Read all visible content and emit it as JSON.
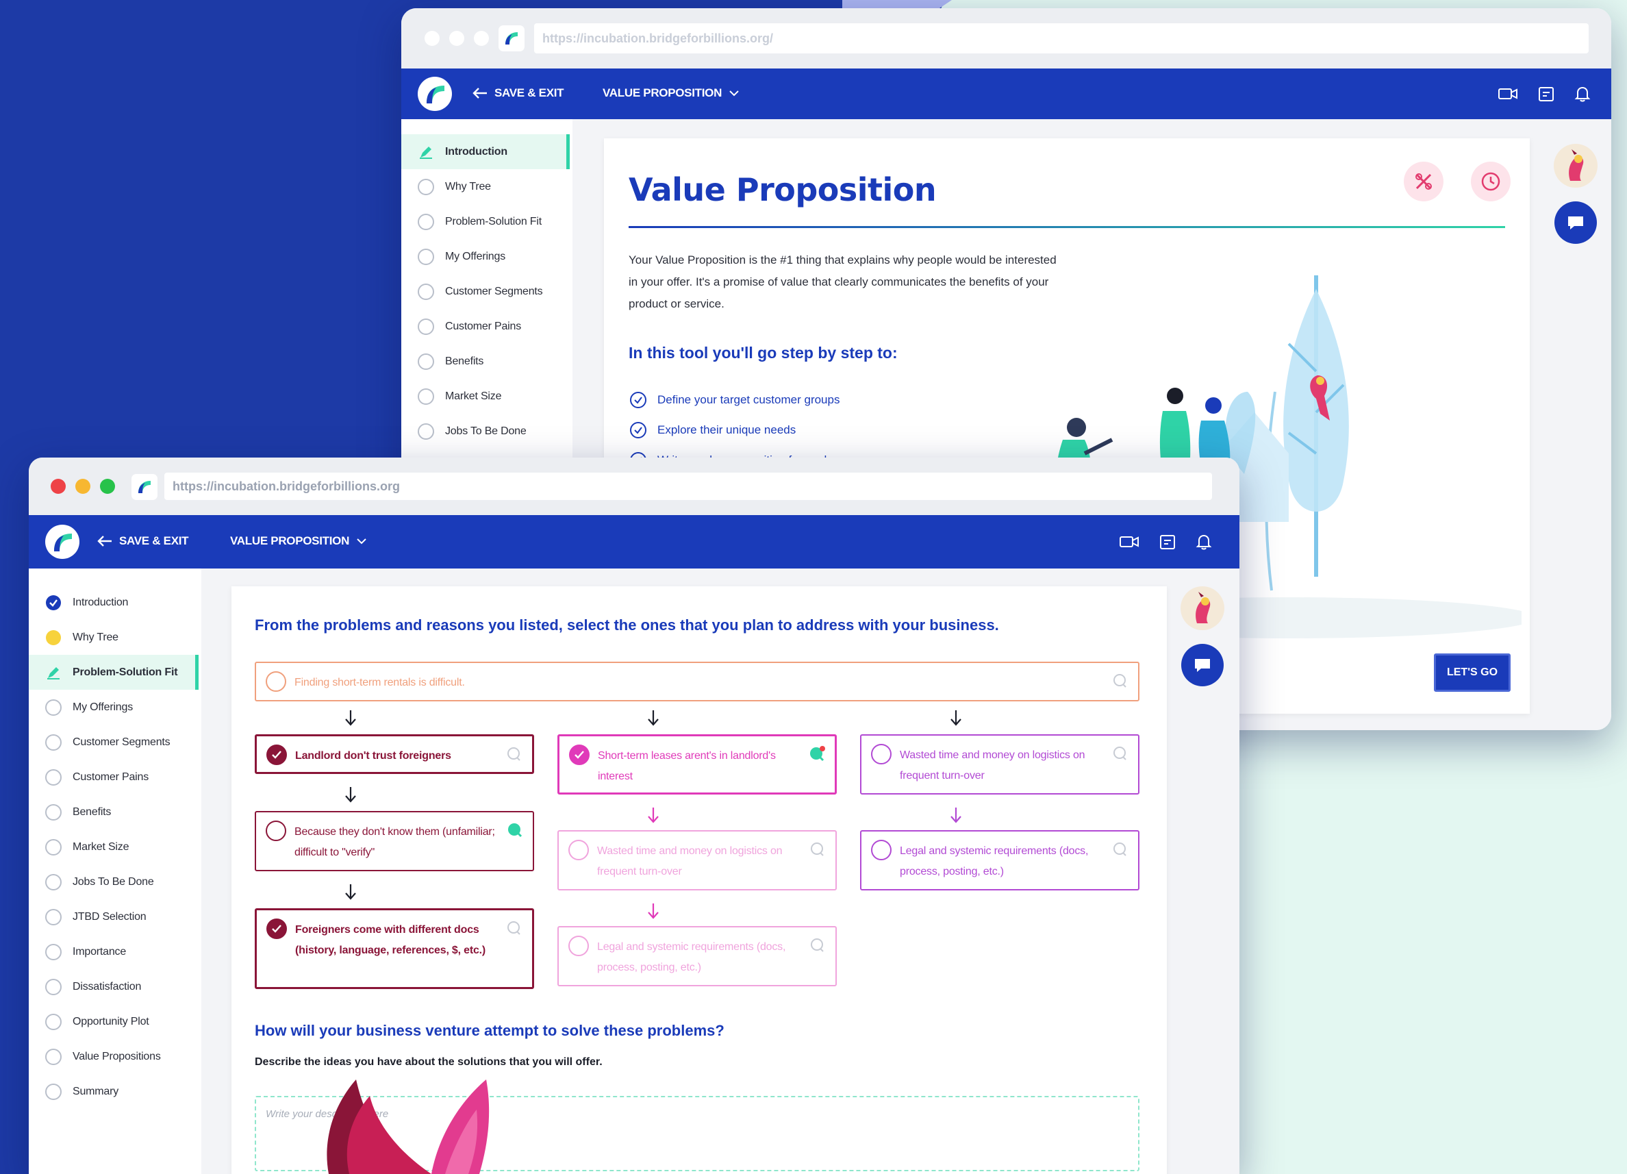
{
  "colors": {
    "brand_blue": "#1a3bb9",
    "teal": "#2fd3a7",
    "background_blue": "#1d3aa6",
    "background_mint": "#e3f7f1",
    "maroon": "#8a1538",
    "magenta": "#e03ab9",
    "violet": "#b24ad4",
    "orange": "#f0a07d"
  },
  "back_window": {
    "url": "https://incubation.bridgeforbillions.org/",
    "save_exit": "SAVE & EXIT",
    "menu_title": "VALUE PROPOSITION",
    "sidebar": [
      {
        "label": "Introduction",
        "state": "active"
      },
      {
        "label": "Why Tree",
        "state": "todo"
      },
      {
        "label": "Problem-Solution Fit",
        "state": "todo"
      },
      {
        "label": "My Offerings",
        "state": "todo"
      },
      {
        "label": "Customer Segments",
        "state": "todo"
      },
      {
        "label": "Customer Pains",
        "state": "todo"
      },
      {
        "label": "Benefits",
        "state": "todo"
      },
      {
        "label": "Market Size",
        "state": "todo"
      },
      {
        "label": "Jobs To Be Done",
        "state": "todo"
      }
    ],
    "page_title": "Value Proposition",
    "description": "Your Value Proposition is the #1 thing that explains why people would be interested in your offer. It's a promise of value that clearly communicates the benefits of your product or service.",
    "subtitle": "In this tool you'll go step by step to:",
    "steps": [
      "Define your target customer groups",
      "Explore their unique needs",
      "Write a value proposition for each one"
    ],
    "cta": "LET'S GO"
  },
  "front_window": {
    "url": "https://incubation.bridgeforbillions.org",
    "save_exit": "SAVE & EXIT",
    "menu_title": "VALUE PROPOSITION",
    "sidebar": [
      {
        "label": "Introduction",
        "state": "done"
      },
      {
        "label": "Why Tree",
        "state": "partial"
      },
      {
        "label": "Problem-Solution Fit",
        "state": "active"
      },
      {
        "label": "My Offerings",
        "state": "todo"
      },
      {
        "label": "Customer Segments",
        "state": "todo"
      },
      {
        "label": "Customer Pains",
        "state": "todo"
      },
      {
        "label": "Benefits",
        "state": "todo"
      },
      {
        "label": "Market Size",
        "state": "todo"
      },
      {
        "label": "Jobs To Be Done",
        "state": "todo"
      },
      {
        "label": "JTBD Selection",
        "state": "todo"
      },
      {
        "label": "Importance",
        "state": "todo"
      },
      {
        "label": "Dissatisfaction",
        "state": "todo"
      },
      {
        "label": "Opportunity Plot",
        "state": "todo"
      },
      {
        "label": "Value Propositions",
        "state": "todo"
      },
      {
        "label": "Summary",
        "state": "todo"
      }
    ],
    "question": "From the problems and reasons you listed, select the ones that you plan to address with your business.",
    "root_problem": "Finding short-term rentals is difficult.",
    "columns": [
      [
        {
          "text": "Landlord don't trust foreigners",
          "selected": true
        },
        {
          "text": "Because they don't know them (unfamiliar; difficult to \"verify\"",
          "selected": false
        },
        {
          "text": "Foreigners come with different docs (history, language, references, $, etc.)",
          "selected": true
        }
      ],
      [
        {
          "text": "Short-term leases arent's in landlord's interest",
          "selected": true
        },
        {
          "text": "Wasted time and money on logistics on frequent turn-over",
          "selected": false
        },
        {
          "text": "Legal and systemic requirements (docs, process, posting, etc.)",
          "selected": false
        }
      ],
      [
        {
          "text": "Wasted time and money on logistics on frequent turn-over",
          "selected": false
        },
        {
          "text": "Legal and systemic requirements (docs, process, posting, etc.)",
          "selected": false
        }
      ]
    ],
    "question2": "How will your business venture attempt to solve these problems?",
    "question2_sub": "Describe the ideas you have about the solutions that you will offer.",
    "answer_placeholder": "Write your description here"
  },
  "icons": [
    "logo-icon",
    "back-arrow-icon",
    "chevron-down-icon",
    "video-icon",
    "calendar-icon",
    "bell-icon",
    "pencil-icon",
    "check-circle-icon",
    "comment-icon",
    "arrow-down-icon",
    "close-icon",
    "clock-icon",
    "chat-icon"
  ]
}
